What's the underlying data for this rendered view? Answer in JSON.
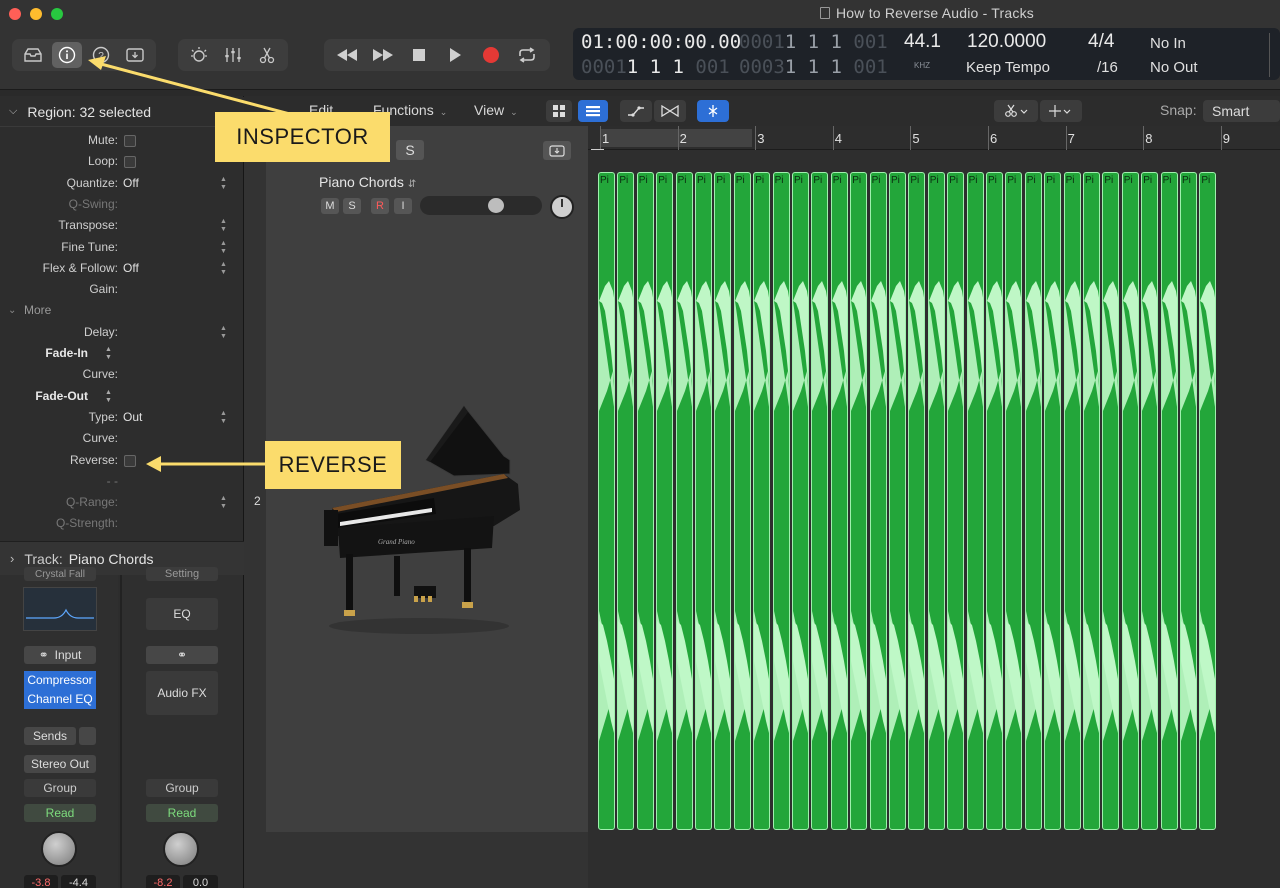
{
  "window": {
    "title": "How to Reverse Audio - Tracks"
  },
  "lcd": {
    "timecode": "01:00:00:00.00",
    "bars_top_dim": "0001",
    "bars_top": "1 1 1",
    "bars_top_dim2": "001",
    "bars_bottom_dim": "0001",
    "bars_bottom": "1 1 1",
    "bars_bottom_dim2": "001",
    "bars2_dim": "0003",
    "bars2": "1 1 1",
    "bars2_dim2": "001",
    "bars3_dim": "0001",
    "bars3": "1 1 1",
    "bars3_dim2": "001",
    "sample_rate": "44.1",
    "sample_unit": "KHZ",
    "tempo": "120.0000",
    "tempo_mode": "Keep Tempo",
    "time_sig": "4/4",
    "division": "/16",
    "midi_in": "No In",
    "midi_out": "No Out"
  },
  "toolbar2": {
    "edit": "Edit",
    "functions": "Functions",
    "view": "View",
    "snap_label": "Snap:",
    "snap_value": "Smart"
  },
  "inspector": {
    "region_header": "Region: 32 selected",
    "rows": [
      {
        "label": "Mute:",
        "value": "",
        "type": "check"
      },
      {
        "label": "Loop:",
        "value": "",
        "type": "check"
      },
      {
        "label": "Quantize:",
        "value": "Off",
        "type": "stepper"
      },
      {
        "label": "Q-Swing:",
        "value": "",
        "type": "dim"
      },
      {
        "label": "Transpose:",
        "value": "",
        "type": "stepper"
      },
      {
        "label": "Fine Tune:",
        "value": "",
        "type": "stepper"
      },
      {
        "label": "Flex & Follow:",
        "value": "Off",
        "type": "stepper"
      },
      {
        "label": "Gain:",
        "value": "",
        "type": "plain"
      }
    ],
    "more_label": "More",
    "more_rows": [
      {
        "label": "Delay:",
        "value": "",
        "type": "stepper"
      },
      {
        "label": "Fade-In",
        "value": "",
        "type": "bold"
      },
      {
        "label": "Curve:",
        "value": "",
        "type": "plain"
      },
      {
        "label": "Fade-Out",
        "value": "",
        "type": "bold"
      },
      {
        "label": "Type:",
        "value": "Out",
        "type": "stepper"
      },
      {
        "label": "Curve:",
        "value": "",
        "type": "plain"
      },
      {
        "label": "Reverse:",
        "value": "",
        "type": "check"
      },
      {
        "label": "- -",
        "value": "",
        "type": "dim"
      },
      {
        "label": "Q-Range:",
        "value": "",
        "type": "dimstepper"
      },
      {
        "label": "Q-Strength:",
        "value": "",
        "type": "dim"
      }
    ],
    "track_header_prefix": "Track:",
    "track_header_name": "Piano Chords"
  },
  "tracks": {
    "header_s": "S",
    "track_name": "Piano Chords",
    "m": "M",
    "s": "S",
    "r": "R",
    "i": "I",
    "track_number": "2",
    "volume_level": 0.65
  },
  "ruler": [
    "1",
    "2",
    "3",
    "4",
    "5",
    "6",
    "7",
    "8",
    "9"
  ],
  "region_label": "Pi",
  "region_count": 32,
  "mixer": {
    "left": {
      "plugin_top": "Crystal Fall",
      "input": "Input",
      "compressor": "Compressor",
      "channel_eq": "Channel EQ",
      "sends": "Sends",
      "output": "Stereo Out",
      "group": "Group",
      "read": "Read",
      "db1": "-3.8",
      "db2": "-4.4"
    },
    "right": {
      "setting": "Setting",
      "eq": "EQ",
      "audio_fx": "Audio FX",
      "group": "Group",
      "read": "Read",
      "db1": "-8.2",
      "db2": "0.0"
    }
  },
  "callouts": {
    "inspector": "INSPECTOR",
    "reverse": "REVERSE"
  },
  "colors": {
    "region": "#23a63a",
    "callout": "#fbdc6c",
    "record": "#e53935",
    "active_blue": "#2d6fd6"
  }
}
